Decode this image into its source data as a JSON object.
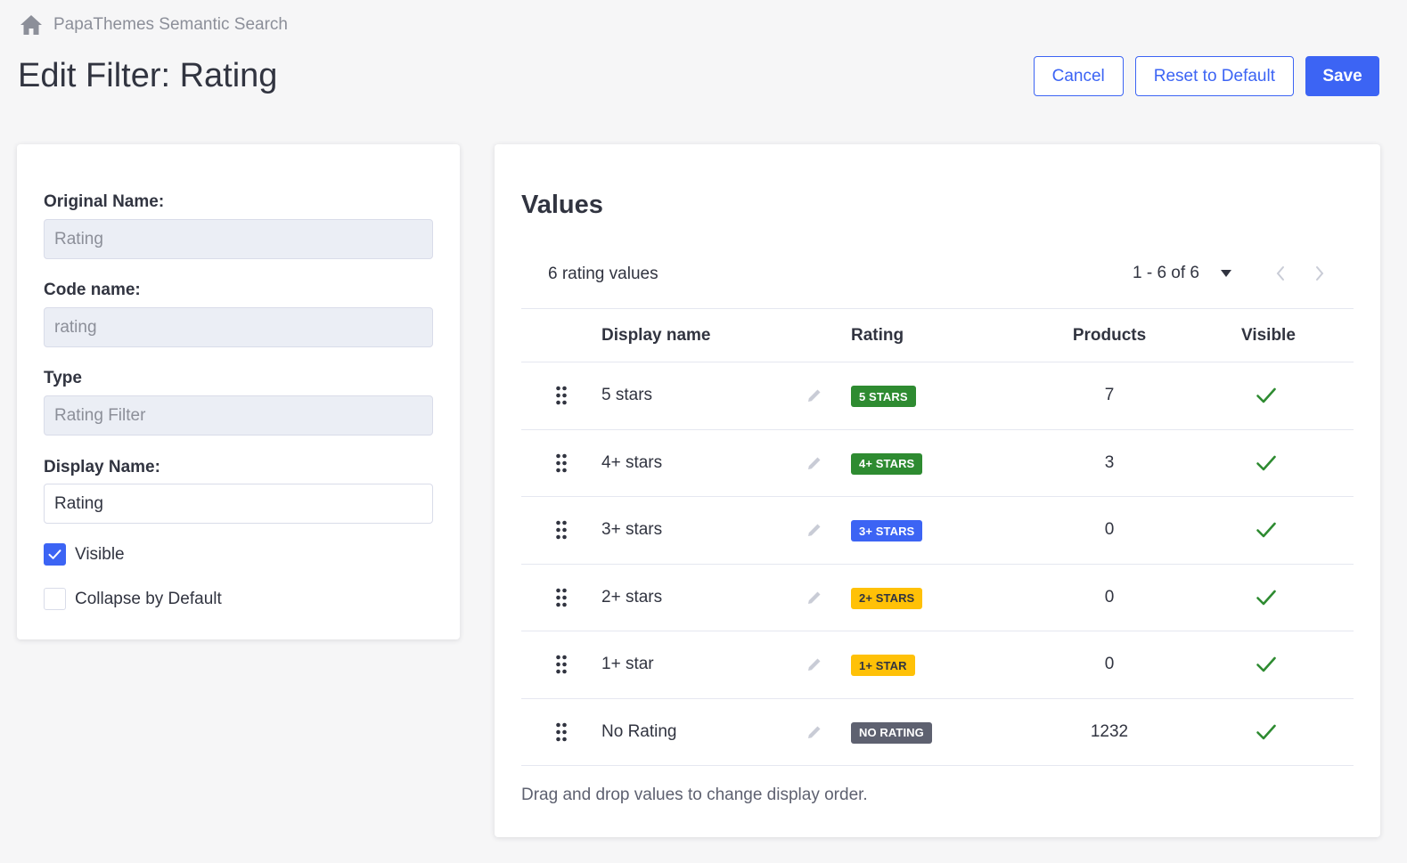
{
  "breadcrumb": {
    "icon": "home-icon",
    "label": "PapaThemes Semantic Search"
  },
  "page": {
    "title": "Edit Filter: Rating"
  },
  "actions": {
    "cancel": "Cancel",
    "reset": "Reset to Default",
    "save": "Save"
  },
  "colors": {
    "primary": "#3c64f4",
    "success": "#2e8b31",
    "warning": "#ffc107",
    "dark": "#5e6170"
  },
  "form": {
    "original_name_label": "Original Name:",
    "original_name_value": "Rating",
    "code_name_label": "Code name:",
    "code_name_value": "rating",
    "type_label": "Type",
    "type_value": "Rating Filter",
    "display_name_label": "Display Name:",
    "display_name_value": "Rating",
    "visible_label": "Visible",
    "visible_checked": true,
    "collapse_label": "Collapse by Default",
    "collapse_checked": false
  },
  "values": {
    "title": "Values",
    "count_label": "6 rating values",
    "page_range": "1 - 6 of 6",
    "columns": {
      "display_name": "Display name",
      "rating": "Rating",
      "products": "Products",
      "visible": "Visible"
    },
    "rows": [
      {
        "name": "5 stars",
        "badge": "5 STARS",
        "badge_color": "#2e8b31",
        "badge_text_color": "#ffffff",
        "products": "7",
        "visible": true
      },
      {
        "name": "4+ stars",
        "badge": "4+ STARS",
        "badge_color": "#2e8b31",
        "badge_text_color": "#ffffff",
        "products": "3",
        "visible": true
      },
      {
        "name": "3+ stars",
        "badge": "3+ STARS",
        "badge_color": "#3c64f4",
        "badge_text_color": "#ffffff",
        "products": "0",
        "visible": true
      },
      {
        "name": "2+ stars",
        "badge": "2+ STARS",
        "badge_color": "#ffc107",
        "badge_text_color": "#313440",
        "products": "0",
        "visible": true
      },
      {
        "name": "1+ star",
        "badge": "1+ STAR",
        "badge_color": "#ffc107",
        "badge_text_color": "#313440",
        "products": "0",
        "visible": true
      },
      {
        "name": "No Rating",
        "badge": "NO RATING",
        "badge_color": "#5e6170",
        "badge_text_color": "#ffffff",
        "products": "1232",
        "visible": true
      }
    ],
    "hint": "Drag and drop values to change display order."
  }
}
